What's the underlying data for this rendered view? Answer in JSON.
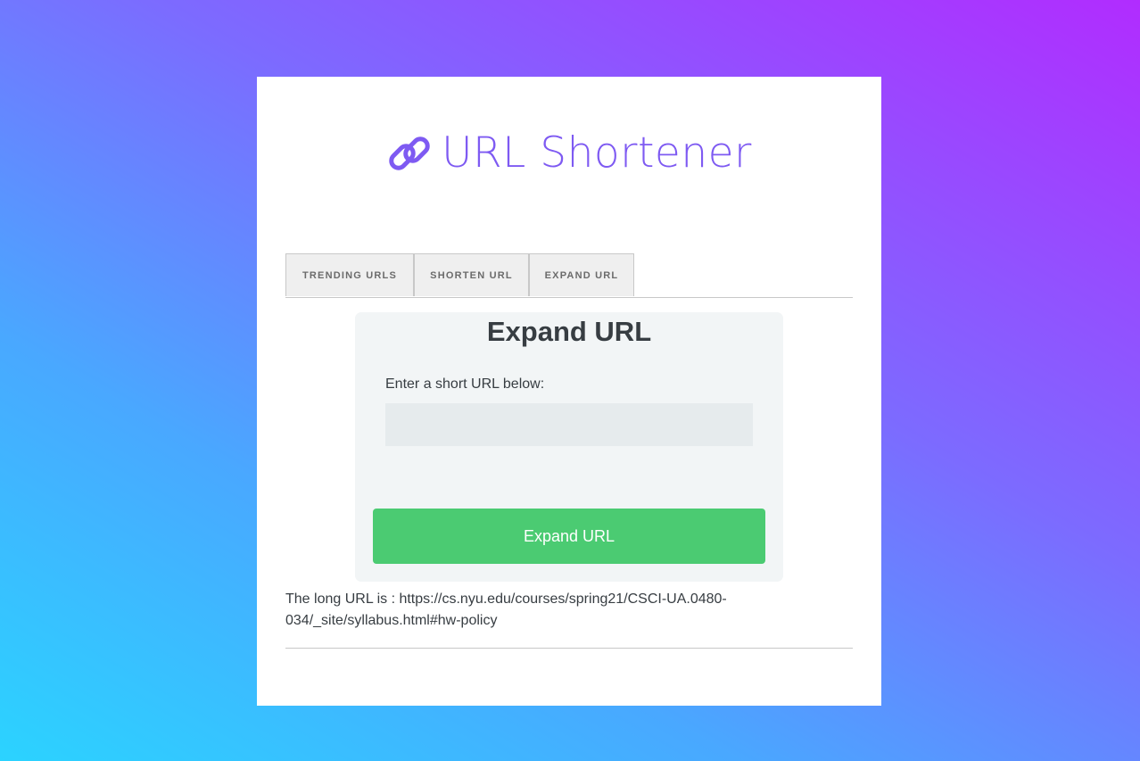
{
  "app": {
    "title": "URL Shortener",
    "logo_icon": "link-icon",
    "brand_color": "#7e5af2"
  },
  "tabs": [
    {
      "label": "TRENDING URLS"
    },
    {
      "label": "SHORTEN URL"
    },
    {
      "label": "EXPAND URL"
    }
  ],
  "panel": {
    "title": "Expand URL",
    "field_label": "Enter a short URL below:",
    "input_value": "",
    "button_label": "Expand URL",
    "button_color": "#4bcb72"
  },
  "result": {
    "text": "The long URL is : https://cs.nyu.edu/courses/spring21/CSCI-UA.0480-034/_site/syllabus.html#hw-policy"
  }
}
